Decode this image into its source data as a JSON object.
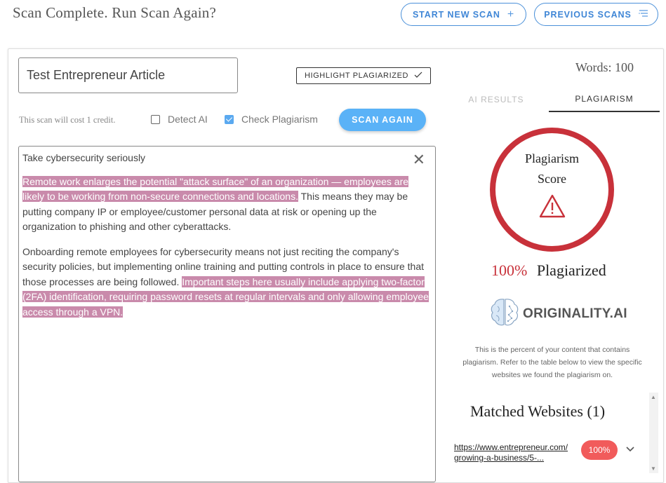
{
  "header": {
    "title": "Scan Complete. Run Scan Again?",
    "start_new_scan": "START NEW SCAN",
    "previous_scans": "PREVIOUS SCANS"
  },
  "form": {
    "title_value": "Test Entrepreneur Article",
    "highlight_btn": "HIGHLIGHT PLAGIARIZED",
    "cost_text": "This scan will cost 1 credit.",
    "detect_ai_label": "Detect AI",
    "detect_ai_checked": false,
    "check_plag_label": "Check Plagiarism",
    "check_plag_checked": true,
    "scan_again": "SCAN AGAIN"
  },
  "editor": {
    "heading": "Take cybersecurity seriously",
    "p1_highlighted": "Remote work enlarges the potential \"attack surface\" of an organization — employees are likely to be working from non-secure connections and locations.",
    "p1_rest": " This means they may be putting company IP or employee/customer personal data at risk or opening up the organization to phishing and other cyberattacks.",
    "p2_plain": "Onboarding remote employees for cybersecurity means not just reciting the company's security policies, but implementing online training and putting controls in place to ensure that those processes are being followed. ",
    "p2_highlighted": "Important steps here usually include applying two-factor (2FA) identification, requiring password resets at regular intervals and only allowing employee access through a VPN."
  },
  "results": {
    "words": "Words: 100",
    "tab_ai": "AI RESULTS",
    "tab_plag": "PLAGIARISM",
    "score_line1": "Plagiarism",
    "score_line2": "Score",
    "percent": "100%",
    "plagiarized_label": "Plagiarized",
    "logo_text": "ORIGINALITY.AI",
    "description": "This is the percent of your content that contains plagiarism. Refer to the table below to view the specific websites we found the plagiarism on.",
    "matched_title": "Matched Websites (1)",
    "matches": [
      {
        "url_line1": "https://www.entrepreneur.com/",
        "url_line2": "growing-a-business/5-...",
        "score": "100%"
      }
    ]
  },
  "colors": {
    "accent_blue": "#4a90d9",
    "scan_button": "#5ab2f7",
    "highlight": "#c98aab",
    "danger_red": "#c8313a",
    "badge_red": "#f15b5b"
  }
}
